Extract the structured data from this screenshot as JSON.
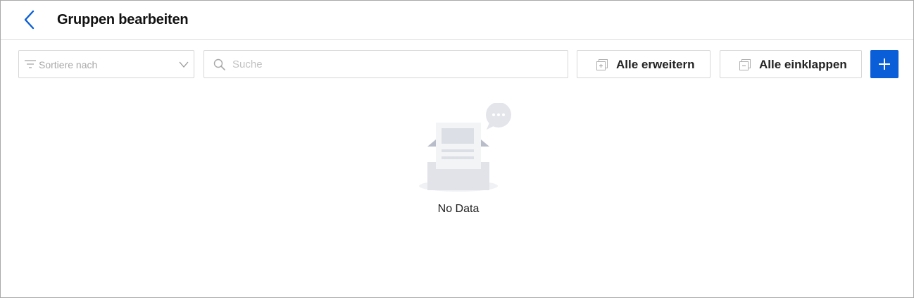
{
  "header": {
    "back_icon": "chevron-left-icon",
    "title": "Gruppen bearbeiten"
  },
  "toolbar": {
    "sort": {
      "placeholder": "Sortiere nach",
      "icon": "filter-icon"
    },
    "search": {
      "placeholder": "Suche",
      "value": "",
      "icon": "search-icon"
    },
    "expand_all_label": "Alle erweitern",
    "collapse_all_label": "Alle einklappen",
    "add_icon": "plus-icon"
  },
  "content": {
    "empty_text": "No Data",
    "empty_icon": "empty-inbox-icon"
  },
  "colors": {
    "accent": "#0a5ed7",
    "border": "#d6d6d6",
    "placeholder": "#a8a8a8"
  }
}
